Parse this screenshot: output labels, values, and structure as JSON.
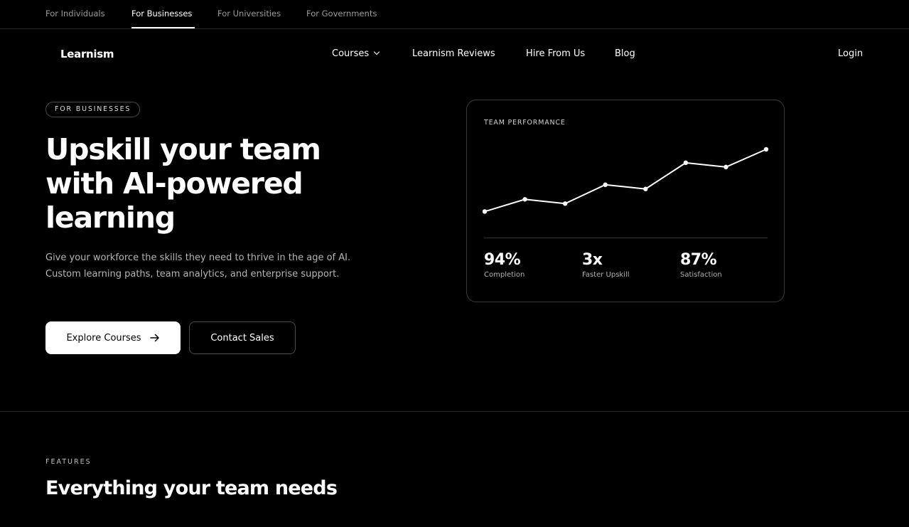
{
  "audience_tabs": [
    {
      "label": "For Individuals"
    },
    {
      "label": "For Businesses"
    },
    {
      "label": "For Universities"
    },
    {
      "label": "For Governments"
    }
  ],
  "active_audience": "For Businesses",
  "nav": {
    "logo": "Learnism",
    "links": [
      {
        "label": "Courses"
      },
      {
        "label": "Learnism Reviews"
      },
      {
        "label": "Hire From Us"
      },
      {
        "label": "Blog"
      }
    ],
    "login": "Login"
  },
  "hero": {
    "eyebrow": "FOR BUSINESSES",
    "headline_lines": [
      "Upskill your team",
      "with AI-powered",
      "learning"
    ],
    "subtext": "Give your workforce the skills they need to thrive in the age of AI. Custom learning paths, team analytics, and enterprise support.",
    "primary_cta": "Explore Courses",
    "primary_cta_icon": "arrow-right-icon",
    "secondary_cta": "Contact Sales"
  },
  "card": {
    "title": "TEAM PERFORMANCE",
    "stats": [
      {
        "value": "94%",
        "label": "Completion"
      },
      {
        "value": "3x",
        "label": "Faster Upskill"
      },
      {
        "value": "87%",
        "label": "Satisfaction"
      }
    ]
  },
  "chart_data": {
    "type": "line",
    "title": "TEAM PERFORMANCE",
    "x": [
      1,
      2,
      3,
      4,
      5,
      6,
      7,
      8
    ],
    "values": [
      10,
      30,
      23,
      54,
      47,
      90,
      83,
      112
    ],
    "ylim": [
      0,
      112
    ],
    "color": "#ffffff",
    "grid": false
  },
  "features": {
    "eyebrow": "FEATURES",
    "title": "Everything your team needs"
  }
}
